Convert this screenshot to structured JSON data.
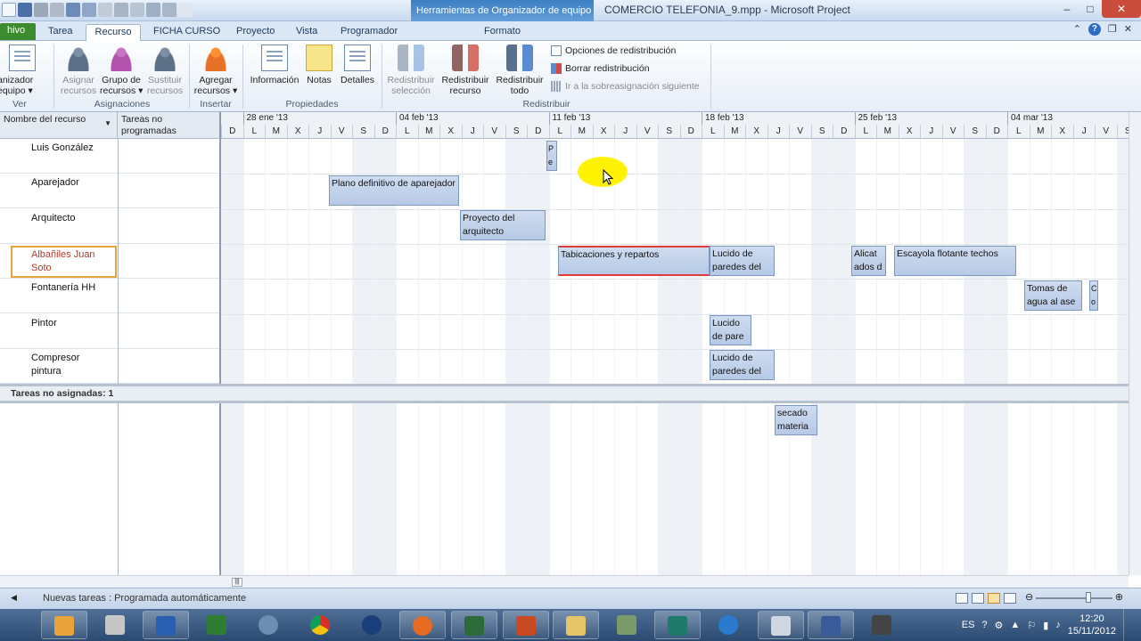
{
  "window": {
    "context_tab_group": "Herramientas de Organizador de equipo",
    "title": "COMERCIO TELEFONIA_9.mpp - Microsoft Project"
  },
  "tabs": [
    {
      "label": "hivo"
    },
    {
      "label": "Tarea"
    },
    {
      "label": "Recurso"
    },
    {
      "label": "FICHA CURSO"
    },
    {
      "label": "Proyecto"
    },
    {
      "label": "Vista"
    },
    {
      "label": "Programador"
    },
    {
      "label": "Formato"
    }
  ],
  "ribbon": {
    "buttons": [
      {
        "label": "Organizador\nde equipo",
        "label_shown": "anizador\nequipo ▾"
      },
      {
        "label": "Asignar\nrecursos"
      },
      {
        "label": "Grupo de\nrecursos ▾"
      },
      {
        "label": "Sustituir\nrecursos"
      },
      {
        "label": "Agregar\nrecursos ▾"
      },
      {
        "label": "Información"
      },
      {
        "label": "Notas"
      },
      {
        "label": "Detalles"
      },
      {
        "label": "Redistribuir\nselección"
      },
      {
        "label": "Redistribuir\nrecurso"
      },
      {
        "label": "Redistribuir\ntodo"
      }
    ],
    "groups": {
      "ver": "Ver",
      "asignaciones": "Asignaciones",
      "insertar": "Insertar",
      "propiedades": "Propiedades",
      "redistribuir": "Redistribuir"
    },
    "small_commands": {
      "opciones": "Opciones de redistribución",
      "borrar": "Borrar redistribución",
      "ir": "Ir a la sobreasignación siguiente"
    }
  },
  "columns": {
    "resource_name": "Nombre del recurso",
    "unscheduled": "Tareas no programadas"
  },
  "timescale": {
    "weeks": [
      "28 ene '13",
      "04 feb '13",
      "11 feb '13",
      "18 feb '13",
      "25 feb '13",
      "04 mar '13"
    ],
    "days": [
      "D",
      "L",
      "M",
      "X",
      "J",
      "V",
      "S",
      "D",
      "L",
      "M",
      "X",
      "J",
      "V",
      "S",
      "D",
      "L",
      "M",
      "X",
      "J",
      "V",
      "S",
      "D",
      "L",
      "M",
      "X",
      "J",
      "V",
      "S",
      "D",
      "L",
      "M",
      "X",
      "J",
      "V",
      "S",
      "D",
      "L",
      "M",
      "X",
      "J",
      "V",
      "S"
    ]
  },
  "resources": [
    {
      "name": "Luis González"
    },
    {
      "name": "Aparejador"
    },
    {
      "name": "Arquitecto"
    },
    {
      "name": "Albañiles Juan Soto",
      "name_shown": "Albañiles Juan\nSoto"
    },
    {
      "name": "Fontanería HH"
    },
    {
      "name": "Pintor"
    },
    {
      "name": "Compresor pintura",
      "name_shown": "Compresor\npintura"
    }
  ],
  "tasks": [
    {
      "label": "P\ne",
      "row": 0
    },
    {
      "label": "Plano definitivo de aparejador",
      "row": 1
    },
    {
      "label": "Proyecto del arquitecto",
      "row": 2
    },
    {
      "label": "Tabicaciones y repartos",
      "row": 3
    },
    {
      "label": "Lucido de paredes del",
      "row": 3
    },
    {
      "label": "Alicat ados d",
      "row": 3
    },
    {
      "label": "Escayola flotante techos",
      "row": 3
    },
    {
      "label": "Tomas de agua al ase",
      "row": 4
    },
    {
      "label": "C o",
      "row": 4
    },
    {
      "label": "Lucido de pare",
      "row": 5
    },
    {
      "label": "Lucido de paredes del",
      "row": 6
    }
  ],
  "unassigned": {
    "header": "Tareas no asignadas: 1",
    "tasks": [
      {
        "label": "secado materia"
      }
    ]
  },
  "statusbar": {
    "new_tasks": "Nuevas tareas : Programada automáticamente"
  },
  "taskbar": {
    "language": "ES",
    "time": "12:20",
    "date": "15/11/2012"
  },
  "colors": {
    "ribbon_accent": "#3c8b2e",
    "bar_fill": "#b6c9e6",
    "overallocation": "#e03a3a",
    "selection_border": "#e7a33b"
  }
}
